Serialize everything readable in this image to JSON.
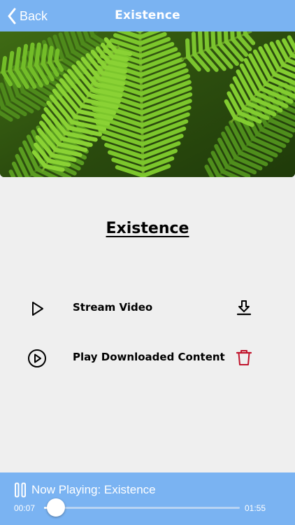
{
  "nav": {
    "back_label": "Back",
    "title": "Existence",
    "back_icon": "chevron-left-icon"
  },
  "hero": {
    "image": "fern-leaves-photo"
  },
  "content": {
    "title": "Existence"
  },
  "actions": [
    {
      "label": "Stream Video",
      "icon": "play-icon",
      "action_icon": "download-icon",
      "action_color": "#000000"
    },
    {
      "label": "Play Downloaded Content",
      "icon": "play-circle-icon",
      "action_icon": "trash-icon",
      "action_color": "#c0142c"
    }
  ],
  "player": {
    "now_playing": "Now Playing: Existence",
    "elapsed": "00:07",
    "total": "01:55",
    "progress_fraction": 0.06,
    "pause_icon": "pause-icon"
  },
  "colors": {
    "accent": "#7ab3f2",
    "background": "#efefef",
    "delete": "#c0142c"
  }
}
